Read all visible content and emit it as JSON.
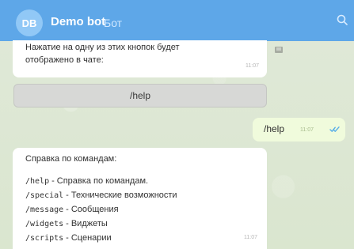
{
  "header": {
    "avatar_text": "DB",
    "title": "Demo bot",
    "subtitle": "Бот"
  },
  "messages": {
    "top_text": "Нажатие на одну из этих кнопок будет\nотображено в чате:",
    "top_time": "11:07",
    "button_label": "/help",
    "sent_text": "/help",
    "sent_time": "11:07",
    "help_title": "Справка по командам:",
    "help_time": "11:07",
    "commands": [
      {
        "cmd": "/help",
        "desc": "Справка по командам."
      },
      {
        "cmd": "/special",
        "desc": "Технические возможности"
      },
      {
        "cmd": "/message",
        "desc": "Сообщения"
      },
      {
        "cmd": "/widgets",
        "desc": "Виджеты"
      },
      {
        "cmd": "/scripts",
        "desc": "Сценарии"
      }
    ]
  },
  "icons": {
    "search": "search-icon",
    "read": "double-check-icon",
    "side": "message-icon"
  }
}
